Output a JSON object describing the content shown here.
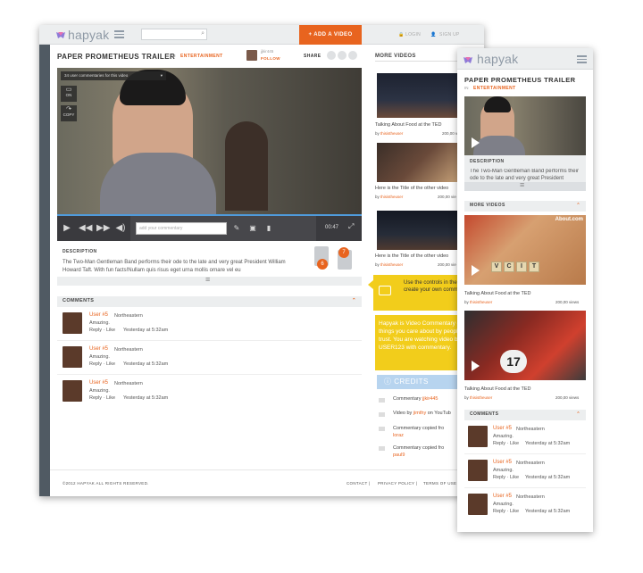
{
  "desktop": {
    "logo": "hapyak",
    "add_video": "+  ADD A VIDEO",
    "login": "LOGIN",
    "signup": "SIGN UP",
    "title": "PAPER PROMETHEUS TRAILER",
    "in": "IN",
    "category": "ENTERTAINMENT",
    "user_handle": "jjkir445",
    "follow": "FOLLOW",
    "share": "SHARE",
    "commentaries_dropdown": "34 user commentaries for this video",
    "on": "ON",
    "copy": "COPY",
    "commentary_placeholder": "add your commentary",
    "time": "00:47",
    "description_label": "DESCRIPTION",
    "description": "The Two-Man Gentleman Band performs their ode to the late and very great President William Howard Taft.  With fun facts!Nullam quis risus eget urna mollis ornare vel eu",
    "likes": "6",
    "dislikes": "7",
    "comments_label": "COMMENTS",
    "comments": [
      {
        "user": "User #5",
        "loc": "Northeastern",
        "text": "Amazing.",
        "actions": "Reply · Like",
        "time": "Yesterday at 5:32am"
      },
      {
        "user": "User #5",
        "loc": "Northeastern",
        "text": "Amazing.",
        "actions": "Reply · Like",
        "time": "Yesterday at 5:32am"
      },
      {
        "user": "User #5",
        "loc": "Northeastern",
        "text": "Amazing.",
        "actions": "Reply · Like",
        "time": "Yesterday at 5:32am"
      }
    ],
    "more_videos": "MORE VIDEOS",
    "side_videos": [
      {
        "title": "Talking About Food at the TED",
        "by": "thisistheuser",
        "views": "200,00 v"
      },
      {
        "title": "Here is the Title of the other video",
        "by": "thisistheuser",
        "views": "200,00 vie"
      },
      {
        "title": "Here is the Title of the other video",
        "by": "thisistheuser",
        "views": "200,00 vie"
      }
    ],
    "tooltip": "Use the controls in the toolbar to create your own commentary",
    "promo": "Hapyak is Video Commentary on things you care about by people you trust. You are watching video by USER123 with commentary.",
    "credits_label": "CREDITS",
    "credits": [
      {
        "pre": "Commentary ",
        "who": "jjkir445"
      },
      {
        "pre": "Video by ",
        "who": "jimthy",
        "post": " on YouTub"
      },
      {
        "pre": "Commentary copied fro",
        "who": "loraz"
      },
      {
        "pre": "Commentary copied fro",
        "who": "paul9"
      }
    ],
    "copyright": "©2012 HAPYAK ALL RIGHTS RESERVED.",
    "footer_links": [
      "CONTACT  |",
      "PRIVACY POLICY  |",
      "TERMS OF USE"
    ]
  },
  "mobile": {
    "logo": "hapyak",
    "title": "PAPER PROMETHEUS TRAILER",
    "in": "IN",
    "category": "ENTERTAINMENT",
    "description_label": "DESCRIPTION",
    "description": "The Two-Man Gentleman Band performs their ode to the late and very great President William Howard Taft. With fun fact",
    "more_videos": "MORE VIDEOS",
    "about": "About.com",
    "tiles": [
      "V",
      "C",
      "I",
      "T"
    ],
    "videos": [
      {
        "title": "Talking About Food at the TED",
        "by": "thisistheuser",
        "views": "200,00 views"
      },
      {
        "title": "Talking About Food at the TED",
        "by": "thisistheuser",
        "views": "200,00 views"
      }
    ],
    "kart_number": "17",
    "comments_label": "COMMENTS",
    "comments": [
      {
        "user": "User #5",
        "loc": "Northeastern",
        "text": "Amazing.",
        "actions": "Reply · Like",
        "time": "Yesterday at 5:32am"
      },
      {
        "user": "User #5",
        "loc": "Northeastern",
        "text": "Amazing.",
        "actions": "Reply · Like",
        "time": "Yesterday at 5:32am"
      },
      {
        "user": "User #5",
        "loc": "Northeastern",
        "text": "Amazing.",
        "actions": "Reply · Like",
        "time": "Yesterday at 5:32am"
      }
    ]
  },
  "colors": {
    "accent": "#e8641f",
    "blue": "#3d8fd6",
    "dark": "#505a63",
    "yellow": "#f2cd1b"
  }
}
